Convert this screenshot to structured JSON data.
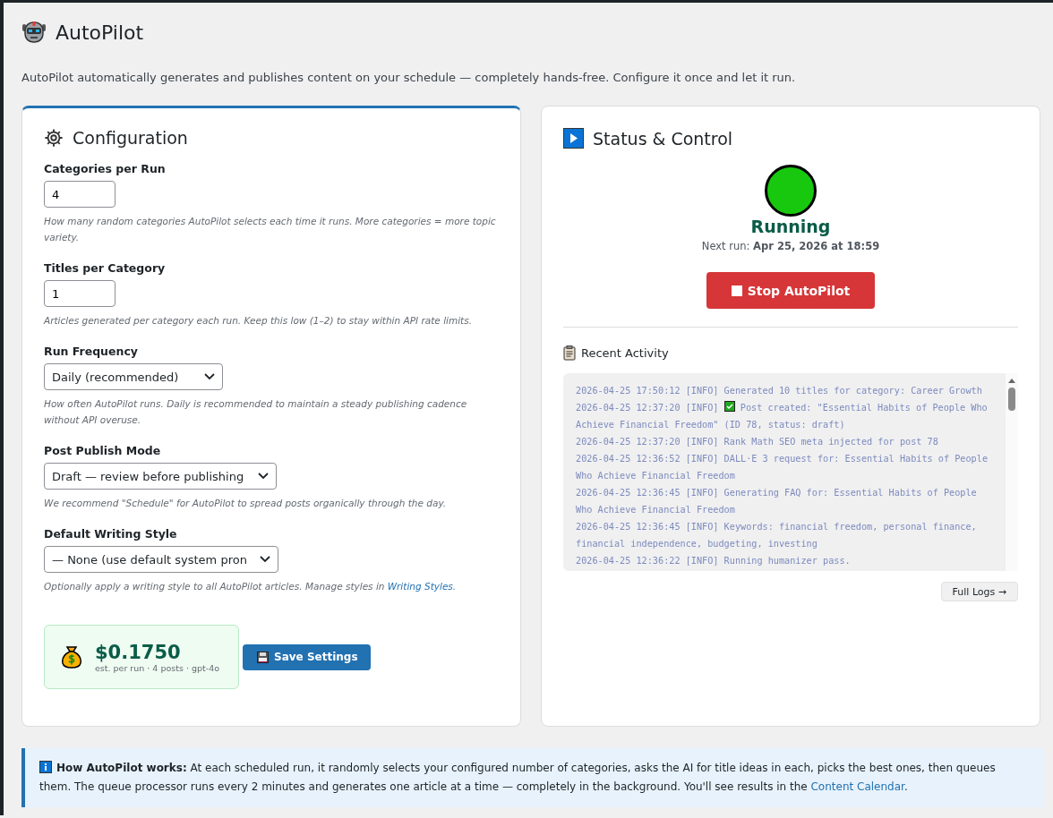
{
  "header": {
    "title": "AutoPilot",
    "description": "AutoPilot automatically generates and publishes content on your schedule — completely hands-free. Configure it once and let it run."
  },
  "config": {
    "title": "Configuration",
    "fields": [
      {
        "kind": "number",
        "label": "Categories per Run",
        "value": "4",
        "hint": "How many random categories AutoPilot selects each time it runs. More categories = more topic variety."
      },
      {
        "kind": "number",
        "label": "Titles per Category",
        "value": "1",
        "hint": "Articles generated per category each run. Keep this low (1–2) to stay within API rate limits."
      },
      {
        "kind": "select",
        "label": "Run Frequency",
        "value": "Daily (recommended)",
        "hint": "How often AutoPilot runs. Daily is recommended to maintain a steady publishing cadence without API overuse."
      },
      {
        "kind": "select",
        "label": "Post Publish Mode",
        "value": "Draft — review before publishing",
        "hint": "We recommend \"Schedule\" for AutoPilot to spread posts organically through the day."
      },
      {
        "kind": "select",
        "label": "Default Writing Style",
        "value": "— None (use default system pron",
        "hint": "Optionally apply a writing style to all AutoPilot articles. Manage styles in",
        "hint_link": "Writing Styles",
        "hint_after": "."
      }
    ],
    "cost": {
      "amount": "$0.1750",
      "caption": "est. per run · 4 posts · gpt-4o"
    },
    "save_button": "Save Settings"
  },
  "status": {
    "title": "Status & Control",
    "state": "Running",
    "running": true,
    "next_run_label": "Next run:",
    "next_run_value": "Apr 25, 2026 at 18:59",
    "stop_button": "Stop AutoPilot",
    "activity_title": "Recent Activity",
    "log": [
      {
        "kind": "info",
        "prefix": "2026-04-25 17:50:12 [INFO]",
        "message": "Generated 10 titles for category: Career Growth"
      },
      {
        "kind": "success",
        "prefix": "2026-04-25 12:37:20 [INFO]",
        "message": "Post created: \"Essential Habits of People Who Achieve Financial Freedom\" (ID 78, status: draft)"
      },
      {
        "kind": "info",
        "prefix": "2026-04-25 12:37:20 [INFO]",
        "message": "Rank Math SEO meta injected for post 78"
      },
      {
        "kind": "info",
        "prefix": "2026-04-25 12:36:52 [INFO]",
        "message": "DALL·E 3 request for: Essential Habits of People Who Achieve Financial Freedom"
      },
      {
        "kind": "info",
        "prefix": "2026-04-25 12:36:45 [INFO]",
        "message": "Generating FAQ for: Essential Habits of People Who Achieve Financial Freedom"
      },
      {
        "kind": "info",
        "prefix": "2026-04-25 12:36:45 [INFO]",
        "message": "Keywords: financial freedom, personal finance, financial independence, budgeting, investing"
      },
      {
        "kind": "info",
        "prefix": "2026-04-25 12:36:22 [INFO]",
        "message": "Running humanizer pass."
      }
    ],
    "full_logs_button": "Full Logs →"
  },
  "notice": {
    "heading": "How AutoPilot works:",
    "text": "At each scheduled run, it randomly selects your configured number of categories, asks the AI for title ideas in each, picks the best ones, then queues them. The queue processor runs every 2 minutes and generates one article at a time — completely in the background. You'll see results in the",
    "link": "Content Calendar",
    "after": "."
  }
}
